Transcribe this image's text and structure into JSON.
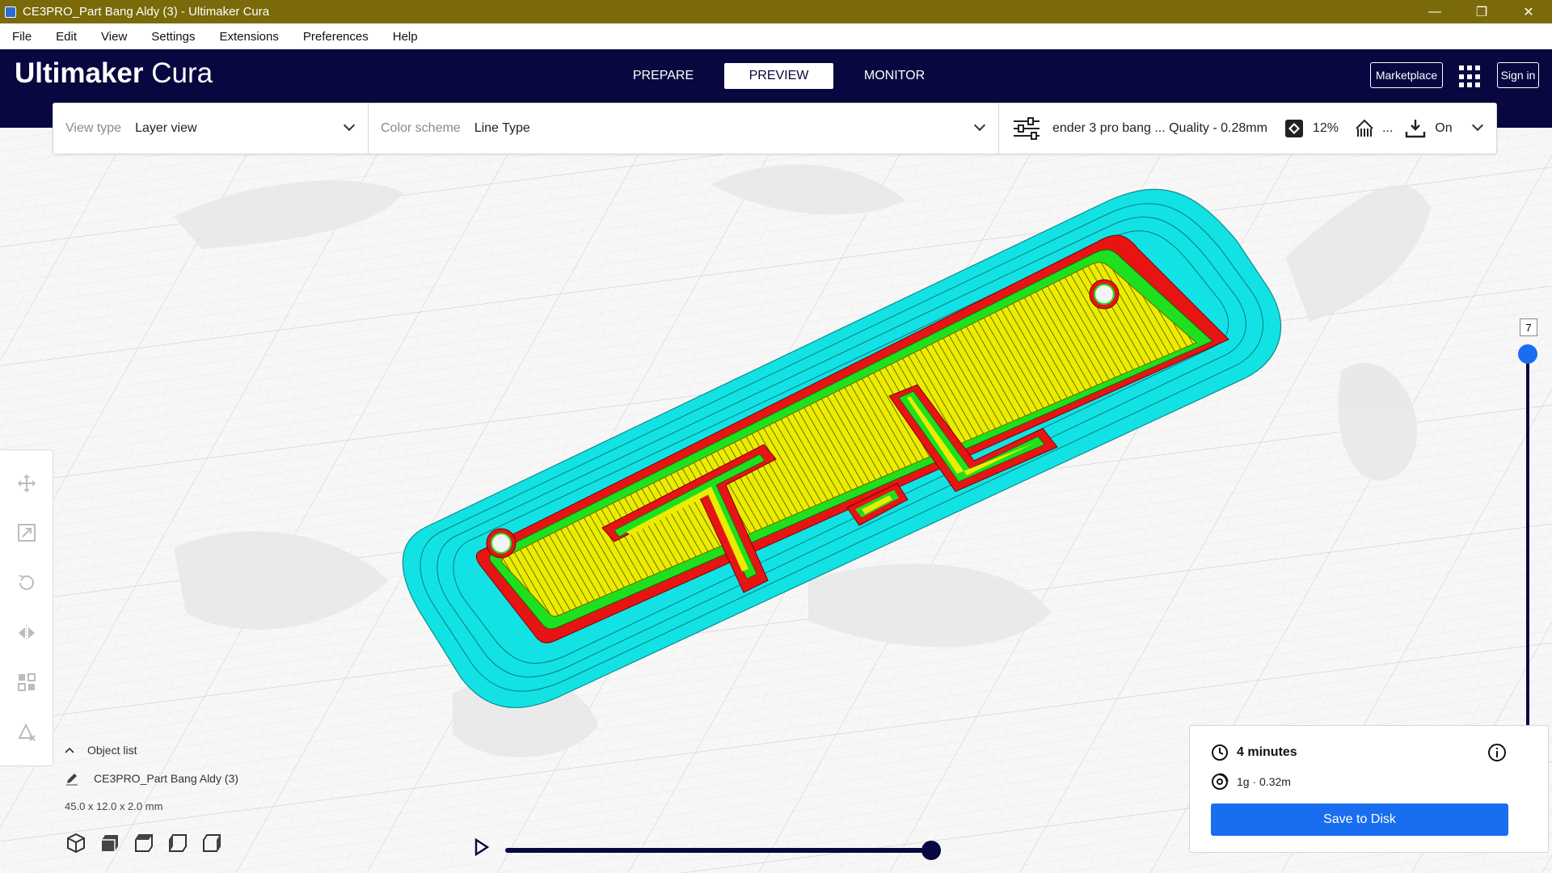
{
  "window": {
    "title": "CE3PRO_Part Bang Aldy (3) - Ultimaker Cura",
    "minimize": "—",
    "restore": "❐",
    "close": "✕"
  },
  "menu": [
    "File",
    "Edit",
    "View",
    "Settings",
    "Extensions",
    "Preferences",
    "Help"
  ],
  "header": {
    "logo_bold": "Ultimaker",
    "logo_light": "Cura",
    "tabs": [
      "PREPARE",
      "PREVIEW",
      "MONITOR"
    ],
    "active_tab": "PREVIEW",
    "marketplace": "Marketplace",
    "sign_in": "Sign in"
  },
  "toolbar": {
    "view_type_label": "View type",
    "view_type_value": "Layer view",
    "color_scheme_label": "Color scheme",
    "color_scheme_value": "Line Type",
    "profile": "ender 3 pro bang ... Quality - 0.28mm",
    "infill": "12%",
    "support": "...",
    "adhesion": "On"
  },
  "layer_slider": {
    "current_layer": "7",
    "top_fraction": 1.0,
    "bottom_fraction": 0.0
  },
  "playback": {
    "progress": 1.0
  },
  "object_list": {
    "header": "Object list",
    "item": "CE3PRO_Part Bang Aldy (3)",
    "dimensions": "45.0 x 12.0 x 2.0 mm"
  },
  "print_info": {
    "time": "4 minutes",
    "material": "1g · 0.32m",
    "save_button": "Save to Disk"
  },
  "colors": {
    "header_bg": "#08073f",
    "titlebar_bg": "#7a6a0a",
    "accent_blue": "#196ef0",
    "skirt": "#12e2e4",
    "outer_wall": "#e81414",
    "inner_wall": "#1fe01f",
    "infill": "#e6e600"
  }
}
